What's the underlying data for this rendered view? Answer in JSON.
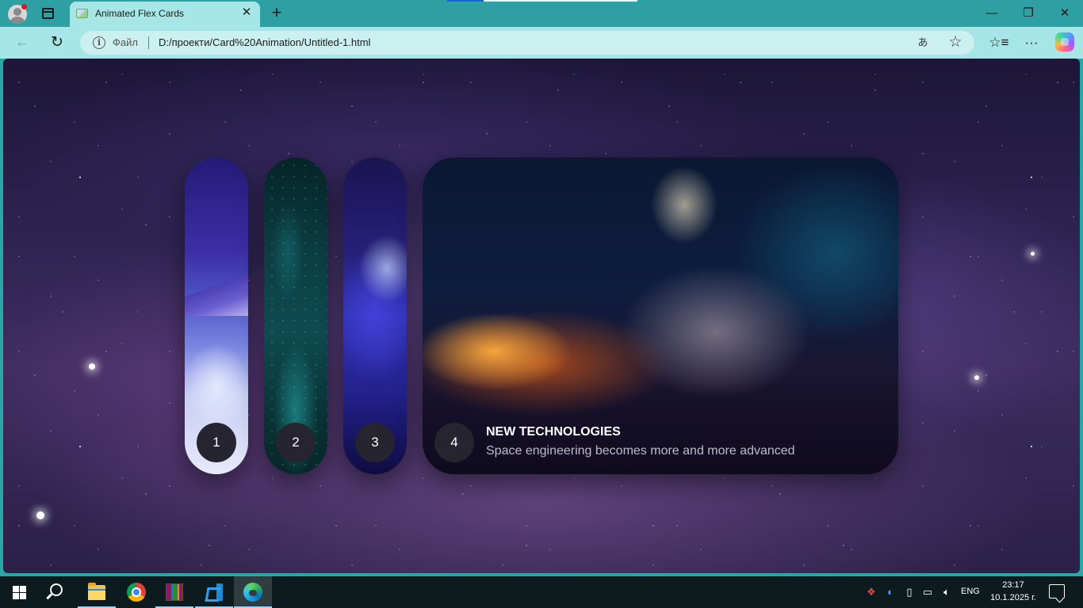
{
  "browser": {
    "tab": {
      "title": "Animated Flex Cards",
      "close": "✕"
    },
    "new_tab": "+",
    "window_controls": {
      "minimize": "—",
      "maximize": "❐",
      "close": "✕"
    },
    "nav": {
      "back": "←",
      "refresh": "↻"
    },
    "omnibox": {
      "info": "i",
      "scheme_label": "Файл",
      "url": "D:/проекти/Card%20Animation/Untitled-1.html",
      "read_aloud": "あ",
      "favorite": "☆"
    },
    "toolbar": {
      "collections": "☆≡",
      "more": "···"
    }
  },
  "cards": [
    {
      "number": "1"
    },
    {
      "number": "2"
    },
    {
      "number": "3"
    },
    {
      "number": "4",
      "title": "New technologies",
      "description": "Space engineering becomes more and more advanced"
    }
  ],
  "taskbar": {
    "apps": [
      "start-icon",
      "search-icon",
      "file-explorer-icon",
      "chrome-icon",
      "winrar-icon",
      "vscode-icon",
      "edge-icon"
    ],
    "tray": {
      "language": "ENG",
      "time": "23:17",
      "date": "10.1.2025 г."
    }
  }
}
